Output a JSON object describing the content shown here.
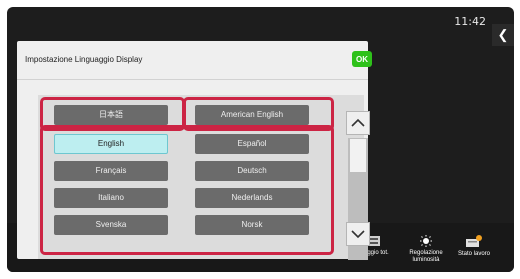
{
  "status": {
    "time": "11:42"
  },
  "dialog": {
    "title": "Impostazione Linguaggio Display",
    "ok_label": "OK"
  },
  "languages": [
    {
      "label": "日本語",
      "selected": false
    },
    {
      "label": "American English",
      "selected": false
    },
    {
      "label": "English",
      "selected": true
    },
    {
      "label": "Español",
      "selected": false
    },
    {
      "label": "Français",
      "selected": false
    },
    {
      "label": "Deutsch",
      "selected": false
    },
    {
      "label": "Italiano",
      "selected": false
    },
    {
      "label": "Nederlands",
      "selected": false
    },
    {
      "label": "Svenska",
      "selected": false
    },
    {
      "label": "Norsk",
      "selected": false
    }
  ],
  "bottom_bar": {
    "items": [
      {
        "label": "...eggio tot.",
        "icon": "counter-icon"
      },
      {
        "label": "Regolazione luminosità",
        "icon": "brightness-icon"
      },
      {
        "label": "Stato lavoro",
        "icon": "job-status-icon"
      }
    ]
  },
  "colors": {
    "ok": "#2ec11a",
    "highlight": "#cc2444",
    "selected": "#bdeef0",
    "button": "#6b6b6b"
  }
}
